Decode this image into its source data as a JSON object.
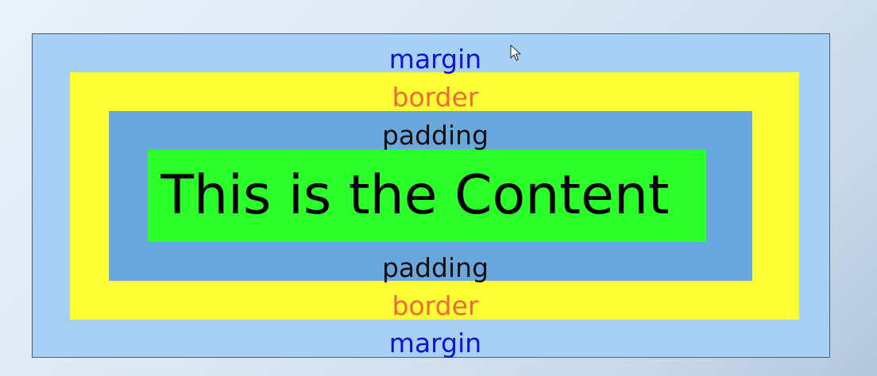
{
  "diagram": {
    "margin_label_top": "margin",
    "border_label_top": "border",
    "padding_label_top": "padding",
    "content_text": "This is the Content",
    "padding_label_bottom": "padding",
    "border_label_bottom": "border",
    "margin_label_bottom": "margin"
  },
  "colors": {
    "margin": "#a7d0f8",
    "border": "#ffff33",
    "padding": "#6aa7dc",
    "content": "#2aff2a",
    "margin_text": "#1010d8",
    "border_text": "#ee6a3a",
    "padding_text": "#101010",
    "content_text": "#000000"
  },
  "icons": {
    "cursor": "mouse-pointer-icon"
  }
}
